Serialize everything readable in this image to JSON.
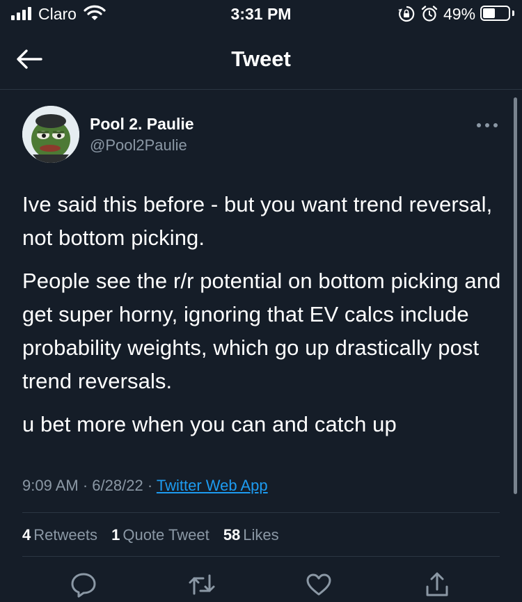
{
  "status_bar": {
    "carrier": "Claro",
    "time": "3:31 PM",
    "battery_percent": "49%",
    "battery_level": 0.49,
    "icons": [
      "signal-icon",
      "wifi-icon",
      "orientation-lock-icon",
      "alarm-icon",
      "battery-icon"
    ]
  },
  "nav": {
    "title": "Tweet",
    "back_icon": "arrow-left-icon"
  },
  "tweet": {
    "author_name": "Pool 2. Paulie",
    "author_handle": "@Pool2Paulie",
    "paragraphs": [
      "Ive said this before - but you want trend reversal, not bottom picking.",
      "People see the r/r potential on bottom picking and get super horny, ignoring that EV calcs include probability weights, which go up drastically post trend reversals.",
      "u bet more when you can and catch up"
    ],
    "time": "9:09 AM",
    "date": "6/28/22",
    "separator": "·",
    "source": "Twitter Web App"
  },
  "stats": {
    "retweets_count": "4",
    "retweets_label": "Retweets",
    "quotes_count": "1",
    "quotes_label": "Quote Tweet",
    "likes_count": "58",
    "likes_label": "Likes"
  },
  "actions": [
    "reply-icon",
    "retweet-icon",
    "like-icon",
    "share-icon"
  ],
  "colors": {
    "background": "#151d28",
    "secondary_text": "#8b98a5",
    "link": "#1d9bf0",
    "divider": "#2b3643"
  }
}
